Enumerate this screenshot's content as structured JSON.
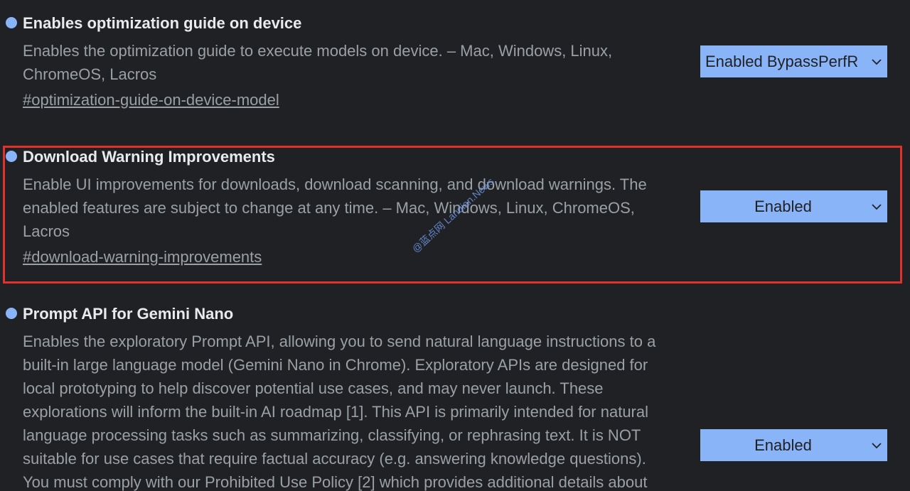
{
  "experiments": [
    {
      "title": "Enables optimization guide on device",
      "description_lines": [
        "Enables the optimization guide to execute models on device. – Mac, Windows, Linux,",
        "ChromeOS, Lacros"
      ],
      "link": "#optimization-guide-on-device-model",
      "selected": "Enabled BypassPerfR"
    },
    {
      "title": "Download Warning Improvements",
      "description_lines": [
        "Enable UI improvements for downloads, download scanning, and download warnings. The",
        "enabled features are subject to change at any time. – Mac, Windows, Linux, ChromeOS,",
        "Lacros"
      ],
      "link": "#download-warning-improvements",
      "selected": "Enabled"
    },
    {
      "title": "Prompt API for Gemini Nano",
      "description_lines": [
        "Enables the exploratory Prompt API, allowing you to send natural language instructions to a",
        "built-in large language model (Gemini Nano in Chrome). Exploratory APIs are designed for",
        "local prototyping to help discover potential use cases, and may never launch. These",
        "explorations will inform the built-in AI roadmap [1]. This API is primarily intended for natural",
        "language processing tasks such as summarizing, classifying, or rephrasing text. It is NOT",
        "suitable for use cases that require factual accuracy (e.g. answering knowledge questions).",
        "You must comply with our Prohibited Use Policy [2] which provides additional details about"
      ],
      "selected": "Enabled"
    }
  ],
  "watermark": "@蓝点网 Landian.News",
  "icons": {
    "chevron": "chevron-down-icon",
    "bullet": "experiment-dot-icon"
  },
  "colors": {
    "background": "#202124",
    "accent": "#8ab4f8",
    "highlight": "#e0312b"
  }
}
